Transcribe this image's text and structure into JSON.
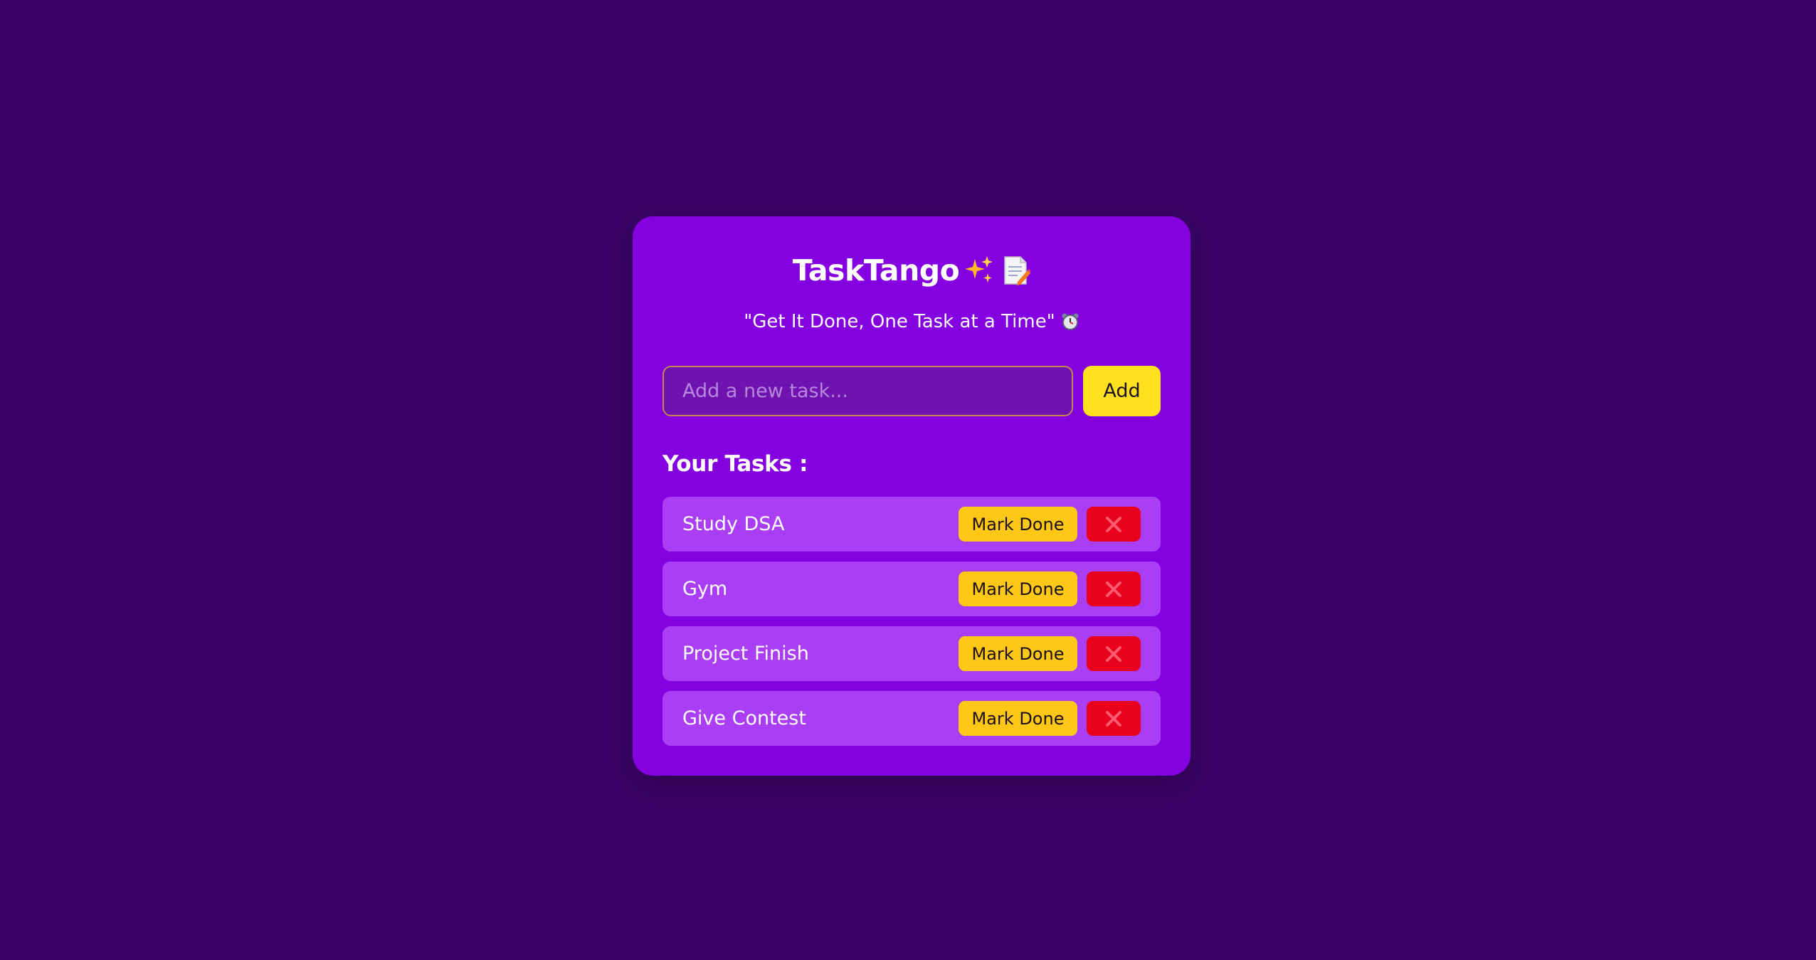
{
  "app": {
    "title": "TaskTango",
    "tagline": "\"Get It Done, One Task at a Time\""
  },
  "icons": {
    "title_icons": [
      "sparkles-icon",
      "memo-icon"
    ],
    "tagline_icon": "alarm-clock-icon",
    "delete_icon": "cross-mark-icon"
  },
  "input": {
    "placeholder": "Add a new task...",
    "value": ""
  },
  "add_label": "Add",
  "tasks_heading": "Your Tasks :",
  "mark_done_label": "Mark Done",
  "tasks": [
    {
      "label": "Study DSA"
    },
    {
      "label": "Gym"
    },
    {
      "label": "Project Finish"
    },
    {
      "label": "Give Contest"
    }
  ],
  "colors": {
    "background": "#3b0367",
    "card": "#8500e0",
    "task_row": "#a93ef5",
    "add_button": "#ffe11d",
    "mark_done_button": "#ffc816",
    "delete_button": "#e9001c"
  }
}
